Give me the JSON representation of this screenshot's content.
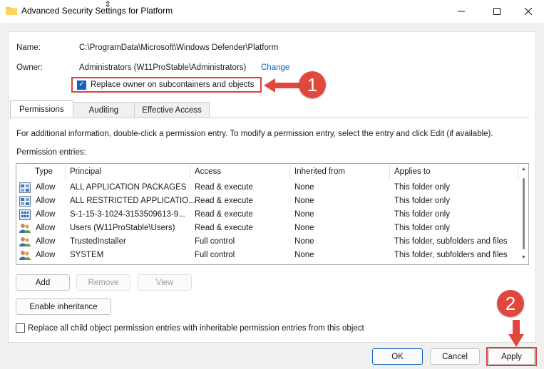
{
  "window": {
    "title": "Advanced Security Settings for Platform"
  },
  "details": {
    "name_label": "Name:",
    "name_value": "C:\\ProgramData\\Microsoft\\Windows Defender\\Platform",
    "owner_label": "Owner:",
    "owner_value": "Administrators (W11ProStable\\Administrators)",
    "change_link": "Change",
    "replace_owner_label": "Replace owner on subcontainers and objects",
    "replace_owner_checked": true
  },
  "callouts": {
    "first": "1",
    "second": "2"
  },
  "tabs": [
    {
      "label": "Permissions",
      "active": true
    },
    {
      "label": "Auditing",
      "active": false
    },
    {
      "label": "Effective Access",
      "active": false
    }
  ],
  "permissions": {
    "info_text": "For additional information, double-click a permission entry. To modify a permission entry, select the entry and click Edit (if available).",
    "entries_label": "Permission entries:",
    "columns": [
      "Type",
      "Principal",
      "Access",
      "Inherited from",
      "Applies to"
    ],
    "rows": [
      {
        "icon": "package-group-icon",
        "type": "Allow",
        "principal": "ALL APPLICATION PACKAGES",
        "access": "Read & execute",
        "inherited": "None",
        "applies": "This folder only"
      },
      {
        "icon": "package-group-icon",
        "type": "Allow",
        "principal": "ALL RESTRICTED APPLICATIO...",
        "access": "Read & execute",
        "inherited": "None",
        "applies": "This folder only"
      },
      {
        "icon": "capability-sid-icon",
        "type": "Allow",
        "principal": "S-1-15-3-1024-3153509613-9...",
        "access": "Read & execute",
        "inherited": "None",
        "applies": "This folder only"
      },
      {
        "icon": "users-group-icon",
        "type": "Allow",
        "principal": "Users (W11ProStable\\Users)",
        "access": "Read & execute",
        "inherited": "None",
        "applies": "This folder only"
      },
      {
        "icon": "users-group-icon",
        "type": "Allow",
        "principal": "TrustedInstaller",
        "access": "Full control",
        "inherited": "None",
        "applies": "This folder, subfolders and files"
      },
      {
        "icon": "users-group-icon",
        "type": "Allow",
        "principal": "SYSTEM",
        "access": "Full control",
        "inherited": "None",
        "applies": "This folder, subfolders and files"
      }
    ]
  },
  "buttons": {
    "add": "Add",
    "remove": "Remove",
    "view": "View",
    "enable_inheritance": "Enable inheritance",
    "ok": "OK",
    "cancel": "Cancel",
    "apply": "Apply"
  },
  "replace_child": {
    "label": "Replace all child object permission entries with inheritable permission entries from this object",
    "checked": false
  },
  "colors": {
    "highlight": "#d9423a",
    "callout": "#e0483e",
    "link": "#0066cc",
    "checkbox": "#0f62c4"
  }
}
